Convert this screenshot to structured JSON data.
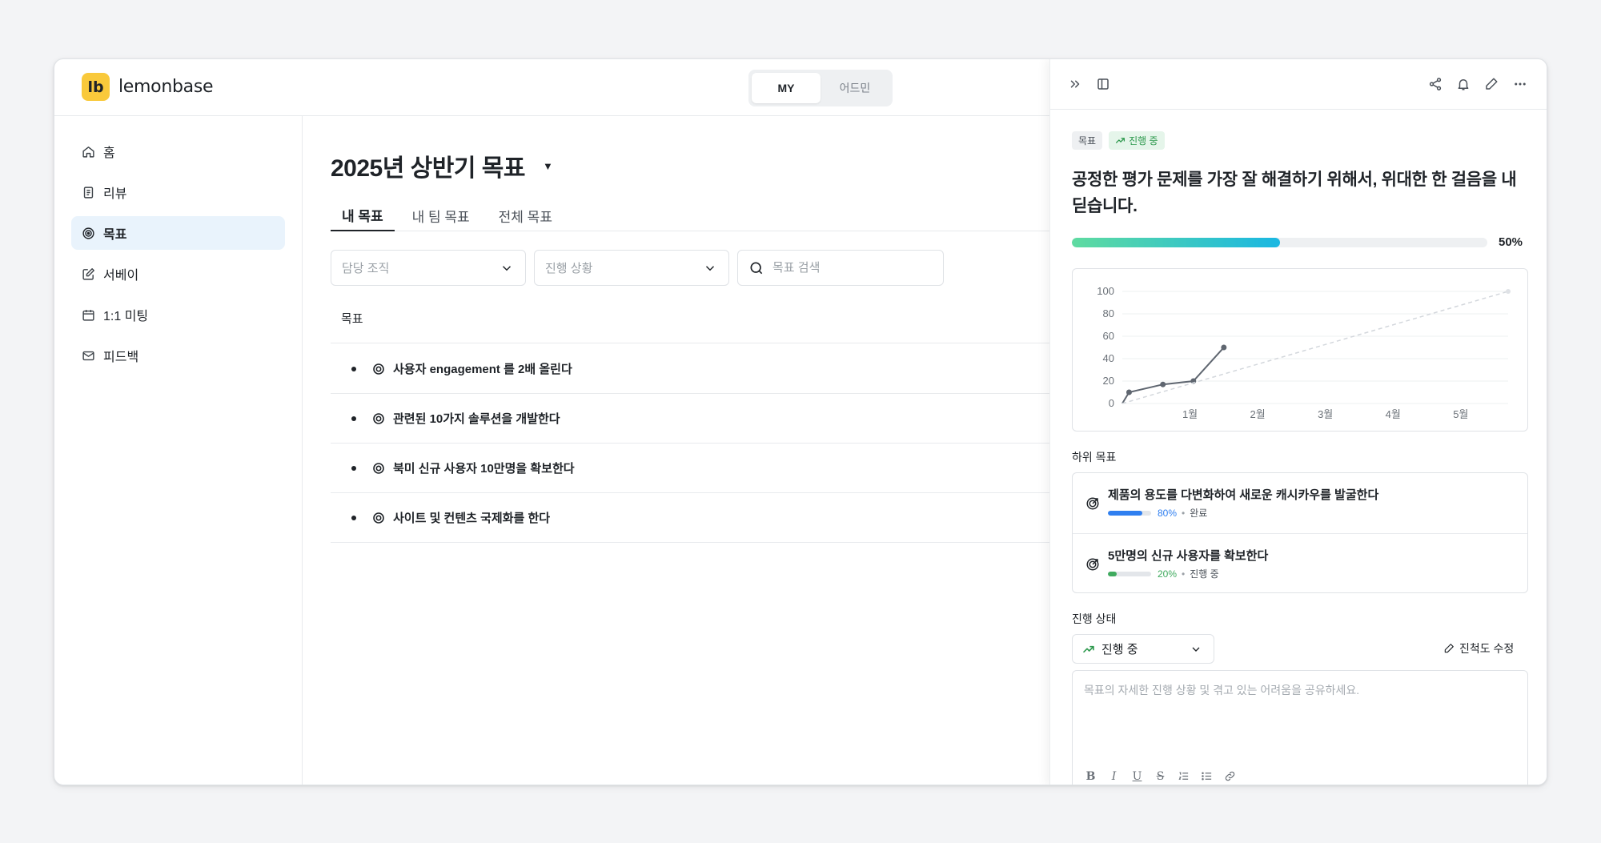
{
  "brand": {
    "logo_mark": "lb",
    "name": "lemonbase"
  },
  "view_toggle": {
    "options": [
      "MY",
      "어드민"
    ],
    "selected": "MY"
  },
  "sidebar": {
    "items": [
      {
        "label": "홈",
        "icon": "home-icon"
      },
      {
        "label": "리뷰",
        "icon": "document-icon"
      },
      {
        "label": "목표",
        "icon": "target-icon",
        "active": true
      },
      {
        "label": "서베이",
        "icon": "edit-icon"
      },
      {
        "label": "1:1 미팅",
        "icon": "calendar-icon"
      },
      {
        "label": "피드백",
        "icon": "mail-icon"
      }
    ]
  },
  "main": {
    "title": "2025년 상반기 목표",
    "tabs": [
      {
        "label": "내 목표",
        "active": true
      },
      {
        "label": "내 팀 목표"
      },
      {
        "label": "전체 목표"
      }
    ],
    "filters": {
      "org_placeholder": "담당 조직",
      "status_placeholder": "진행 상황",
      "search_placeholder": "목표 검색"
    },
    "table": {
      "column": "목표",
      "rows": [
        "사용자 engagement 를 2배 올린다",
        "관련된 10가지 솔루션을 개발한다",
        "북미 신규 사용자 10만명을 확보한다",
        "사이트 및 컨텐츠 국제화를 한다"
      ]
    }
  },
  "panel": {
    "badge_type": "목표",
    "badge_status": "진행 중",
    "title": "공정한 평가 문제를 가장 잘 해결하기 위해서, 위대한 한 걸음을 내딛습니다.",
    "progress": 50,
    "progress_label": "50%",
    "sub_goals_label": "하위 목표",
    "sub_goals": [
      {
        "title": "제품의 용도를 다변화하여 새로운 캐시카우를 발굴한다",
        "progress": 80,
        "progress_label": "80%",
        "status": "완료",
        "color": "#2f7ff0"
      },
      {
        "title": "5만명의 신규 사용자를 확보한다",
        "progress": 20,
        "progress_label": "20%",
        "status": "진행 중",
        "color": "#3faa5e"
      }
    ],
    "status_label": "진행 상태",
    "status_value": "진행 중",
    "edit_progress_label": "진척도 수정",
    "comment_placeholder": "목표의 자세한 진행 상황 및 겪고 있는 어려움을 공유하세요."
  },
  "chart_data": {
    "type": "line",
    "categories": [
      "1월",
      "2월",
      "3월",
      "4월",
      "5월"
    ],
    "y_ticks": [
      0,
      20,
      40,
      60,
      80,
      100
    ],
    "ylim": [
      0,
      100
    ],
    "xlim": [
      0,
      5.7
    ],
    "series": [
      {
        "points": [
          [
            0,
            0
          ],
          [
            0.1,
            10
          ],
          [
            0.6,
            17
          ],
          [
            1.05,
            20
          ],
          [
            1.5,
            50
          ]
        ],
        "color": "#5f6670",
        "style": "solid"
      },
      {
        "points": [
          [
            0,
            0
          ],
          [
            5.7,
            100
          ]
        ],
        "color": "#d3d7dc",
        "style": "dashed"
      }
    ],
    "grid": true
  },
  "colors": {
    "accent": "#f9c93b",
    "active_nav_bg": "#e9f3fc",
    "progress_start": "#5fdba0",
    "progress_end": "#1ab7e2"
  }
}
